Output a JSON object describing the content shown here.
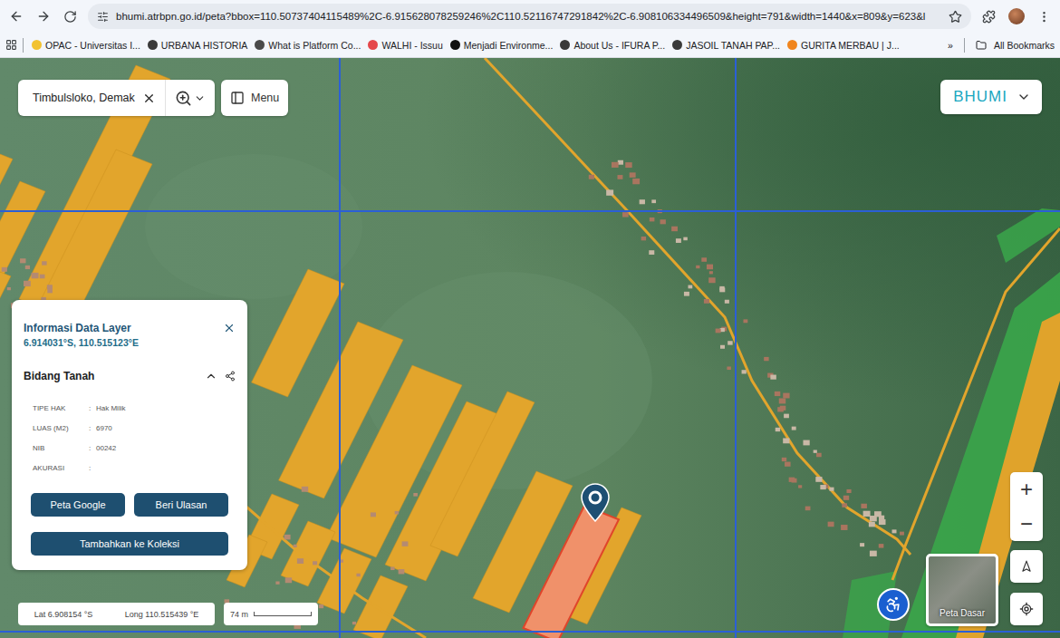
{
  "browser": {
    "url": "bhumi.atrbpn.go.id/peta?bbox=110.50737404115489%2C-6.915628078259246%2C110.52116747291842%2C-6.908106334496509&height=791&width=1440&x=809&y=623&l",
    "bookmarks": [
      {
        "label": "OPAC - Universitas I...",
        "color": "#f2c230"
      },
      {
        "label": "URBANA HISTORIA",
        "color": "#3a3a3a"
      },
      {
        "label": "What is Platform Co...",
        "color": "#4a4a4a"
      },
      {
        "label": "WALHI - Issuu",
        "color": "#e5474b"
      },
      {
        "label": "Menjadi Environme...",
        "color": "#111111"
      },
      {
        "label": "About Us - IFURA P...",
        "color": "#3a3a3a"
      },
      {
        "label": "JASOIL TANAH PAP...",
        "color": "#3a3a3a"
      },
      {
        "label": "GURITA MERBAU | J...",
        "color": "#f0851e"
      }
    ],
    "overflow": "»",
    "all_bookmarks": "All Bookmarks"
  },
  "map": {
    "search": "Timbulsloko, Demak",
    "menu_button": "Menu",
    "logo": "BHUMI",
    "zoom_in": "+",
    "zoom_out": "−",
    "basemap_label": "Peta Dasar"
  },
  "info_panel": {
    "title": "Informasi Data Layer",
    "coordinates": "6.914031°S, 110.515123°E",
    "section": {
      "title": "Bidang Tanah",
      "expanded": true
    },
    "separator": ":",
    "rows": [
      {
        "label": "TIPE HAK",
        "value": "Hak Milik"
      },
      {
        "label": "LUAS (M2)",
        "value": "6970"
      },
      {
        "label": "NIB",
        "value": "00242"
      },
      {
        "label": "AKURASI",
        "value": ""
      }
    ],
    "buttons": [
      "Peta Google",
      "Beri Ulasan"
    ],
    "primary_button": "Tambahkan ke Koleksi"
  },
  "status": {
    "lat": "Lat 6.908154 °S",
    "long": "Long 110.515439 °E",
    "scale": "74 m"
  }
}
